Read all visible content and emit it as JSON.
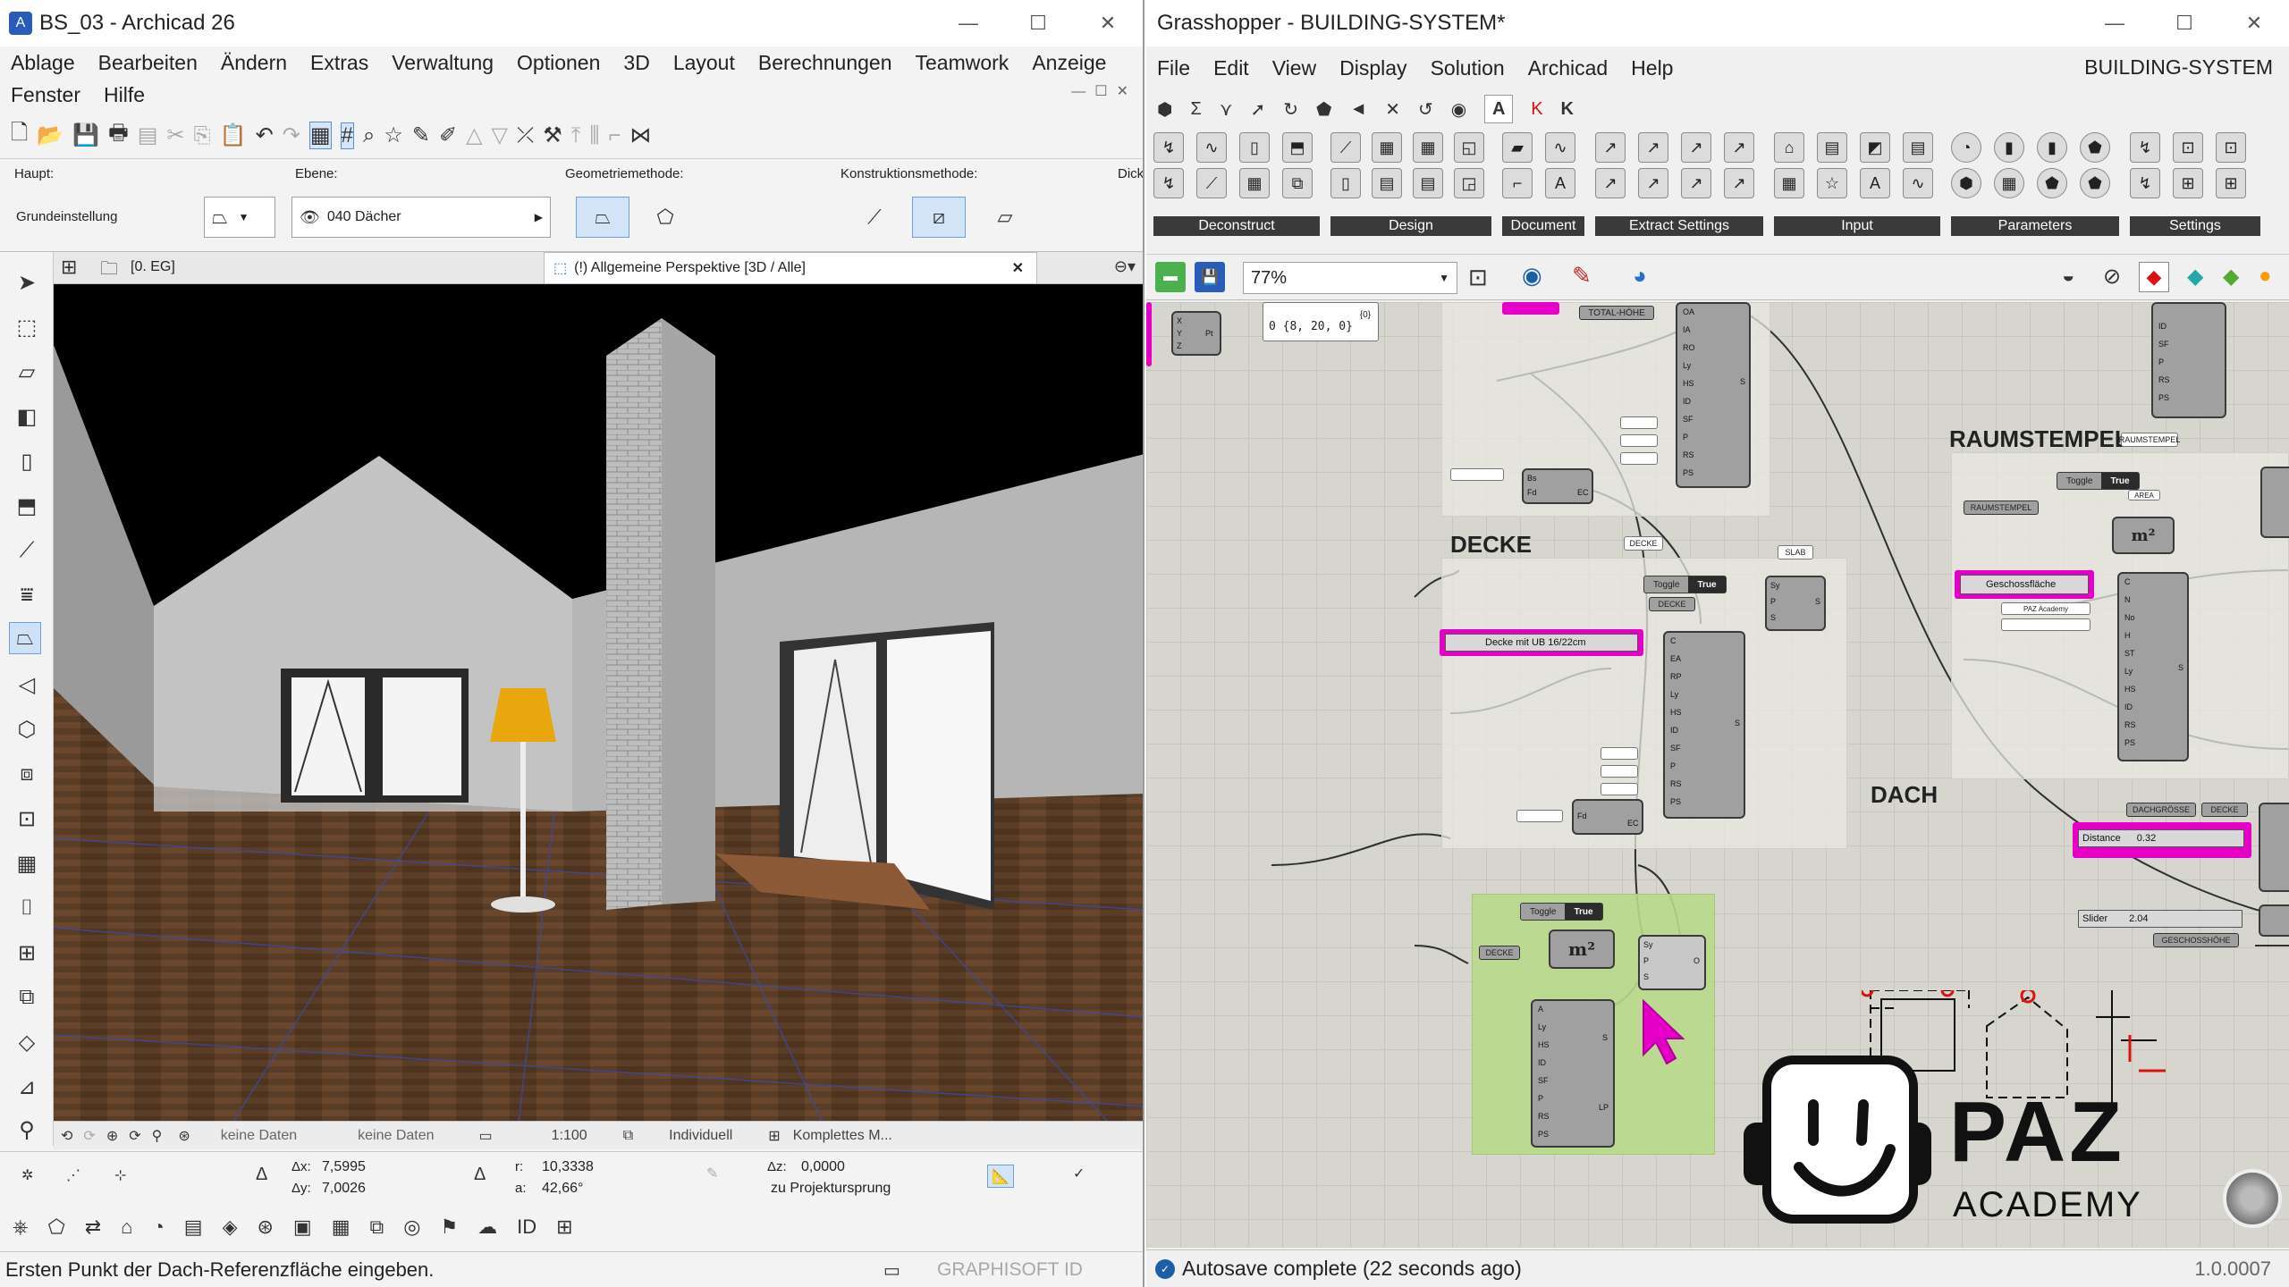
{
  "archicad": {
    "window_title": "BS_03 - Archicad 26",
    "menu": [
      "Ablage",
      "Bearbeiten",
      "Ändern",
      "Extras",
      "Verwaltung",
      "Optionen",
      "3D",
      "Layout",
      "Berechnungen",
      "Teamwork",
      "Anzeige",
      "Fenster",
      "Hilfe"
    ],
    "info_box": {
      "haupt_label": "Haupt:",
      "haupt_value": "Grundeinstellung",
      "ebene_label": "Ebene:",
      "ebene_value": "040 Dächer",
      "geometry_label": "Geometriemethode:",
      "construction_label": "Konstruktionsmethode:",
      "dick_label": "Dick"
    },
    "nav_floor": "[0. EG]",
    "view_tab": "(!) Allgemeine Perspektive [3D / Alle]",
    "bottom_bar": {
      "no_data_1": "keine Daten",
      "no_data_2": "keine Daten",
      "scale": "1:100",
      "layer_combo": "Individuell",
      "model_view": "Komplettes M..."
    },
    "coords": {
      "dx_label": "Δx:",
      "dx": "7,5995",
      "dy_label": "Δy:",
      "dy": "7,0026",
      "r_label": "r:",
      "r": "10,3338",
      "a_label": "a:",
      "a": "42,66°",
      "dz_label": "Δz:",
      "dz": "0,0000",
      "ref": "zu Projektursprung"
    },
    "status": "Ersten Punkt der Dach-Referenzfläche eingeben.",
    "graphisoft_id": "GRAPHISOFT ID"
  },
  "grasshopper": {
    "window_title": "Grasshopper - BUILDING-SYSTEM*",
    "menu": [
      "File",
      "Edit",
      "View",
      "Display",
      "Solution",
      "Archicad",
      "Help"
    ],
    "doc_name": "BUILDING-SYSTEM",
    "ribbon_groups": [
      "Deconstruct",
      "Design",
      "Document",
      "Extract Settings",
      "Input",
      "Parameters",
      "Settings"
    ],
    "zoom": "77%",
    "canvas": {
      "groups": {
        "decke": "DECKE",
        "raumstempel": "RAUMSTEMPEL",
        "dach": "DACH"
      },
      "panel_vector": "{0}",
      "panel_vector_value": "0 {8, 20, 0}",
      "total_hoehe": "TOTAL-HÖHE",
      "decke_tag": "DECKE",
      "slab_tag": "SLAB",
      "raumstempel_tag": "RAUMSTEMPEL",
      "area_tag": "AREA",
      "toggle": "Toggle",
      "true": "True",
      "decke_param": "Decke mit UB 16/22cm",
      "geschossflaeche": "Geschossfläche",
      "paz_academy_panel": "PAZ Academy",
      "dachgroesse": "DACHGRÖSSE",
      "distance": "Distance",
      "distance_value": "0.32",
      "slider": "Slider",
      "slider_value": "2.04",
      "geschosshoehe": "GESCHOSSHÖHE",
      "m2": "m²"
    },
    "status": "Autosave complete (22 seconds ago)",
    "version": "1.0.0007"
  },
  "overlay": {
    "logo_big": "PAZ",
    "logo_small": "ACADEMY"
  },
  "colors": {
    "magenta": "#e600c7",
    "green_group": "#b9d98a",
    "node_gray": "#a0a0a0"
  }
}
